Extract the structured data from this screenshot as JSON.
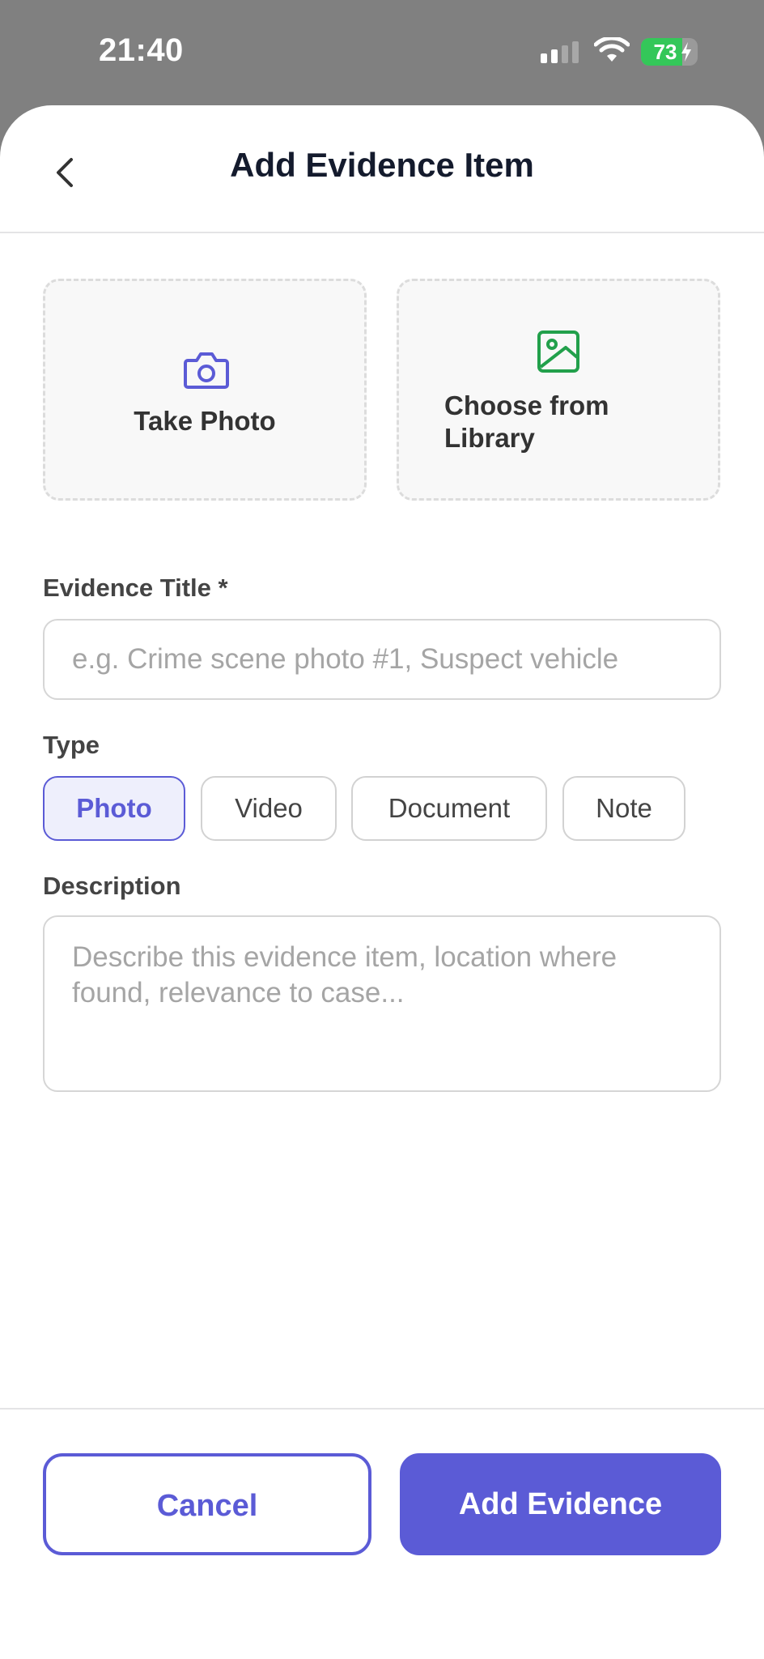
{
  "status_bar": {
    "time": "21:40",
    "battery_percent": "73",
    "battery_level": 0.73
  },
  "header": {
    "title": "Add Evidence Item",
    "back_icon": "chevron-left-icon"
  },
  "media": {
    "take_photo_label": "Take Photo",
    "choose_library_label": "Choose from Library",
    "camera_icon": "camera-icon",
    "image_icon": "image-icon"
  },
  "form": {
    "title_label": "Evidence Title *",
    "title_placeholder": "e.g. Crime scene photo #1, Suspect vehicle",
    "type_label": "Type",
    "types": [
      "Photo",
      "Video",
      "Document",
      "Note"
    ],
    "selected_type": "Photo",
    "description_label": "Description",
    "description_placeholder": "Describe this evidence item, location where found, relevance to case..."
  },
  "actions": {
    "cancel_label": "Cancel",
    "add_label": "Add Evidence"
  },
  "colors": {
    "accent": "#5b5bd6",
    "accent_soft": "#eeeffc",
    "library_icon": "#22a04b",
    "battery": "#34c759"
  }
}
